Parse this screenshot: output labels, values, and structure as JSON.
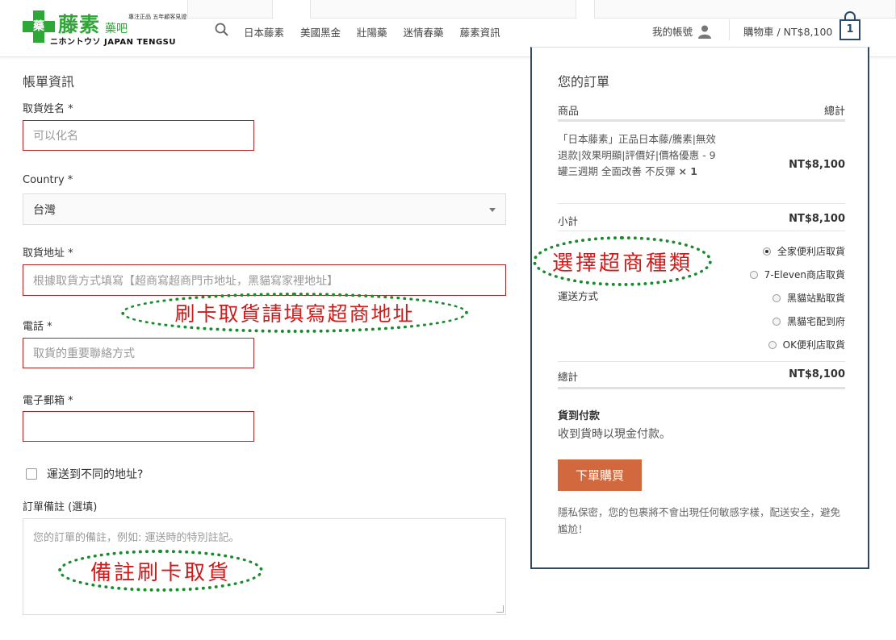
{
  "header": {
    "logo": {
      "mark_char": "藥",
      "main_text": "藤素",
      "small_text": "藥吧",
      "tagline": "專注正品 五年顧客見證",
      "subtitle": "ニホントウソ JAPAN TENGSU"
    },
    "nav": [
      "日本藤素",
      "美國黑金",
      "壯陽藥",
      "迷情春藥",
      "藤素資訊"
    ],
    "account_label": "我的帳號",
    "cart_label": "購物車 / NT$8,100",
    "cart_count": "1"
  },
  "billing": {
    "title": "帳單資訊",
    "name_label": "取貨姓名",
    "name_placeholder": "可以化名",
    "country_label": "Country",
    "country_value": "台灣",
    "address_label": "取貨地址",
    "address_placeholder": "根據取貨方式填寫【超商寫超商門市地址，黑貓寫家裡地址】",
    "phone_label": "電話",
    "phone_placeholder": "取貨的重要聯絡方式",
    "email_label": "電子郵箱",
    "email_placeholder": "",
    "required_mark": "*",
    "ship_different_label": "運送到不同的地址?",
    "notes_label": "訂單備註 (選填)",
    "notes_placeholder": "您的訂單的備註，例如: 運送時的特別註記。"
  },
  "annotations": {
    "address_note": "刷卡取貨請填寫超商地址",
    "shipping_note": "選擇超商種類",
    "notes_note": "備註刷卡取貨"
  },
  "order": {
    "title": "您的訂單",
    "col_product": "商品",
    "col_total": "總計",
    "item_name": "「日本藤素」正品日本藤/騰素|無效退款|效果明顯|評價好|價格優惠 - 9罐三週期 全面改善 不反彈",
    "item_qty": "× 1",
    "item_total": "NT$8,100",
    "subtotal_label": "小計",
    "subtotal_value": "NT$8,100",
    "shipping_label": "運送方式",
    "shipping_options": [
      {
        "label": "全家便利店取貨",
        "selected": true
      },
      {
        "label": "7-Eleven商店取貨",
        "selected": false
      },
      {
        "label": "黑貓站點取貨",
        "selected": false
      },
      {
        "label": "黑貓宅配到府",
        "selected": false
      },
      {
        "label": "OK便利店取貨",
        "selected": false
      }
    ],
    "total_label": "總計",
    "total_value": "NT$8,100",
    "payment_title": "貨到付款",
    "payment_desc": "收到貨時以現金付款。",
    "place_order_label": "下單購買",
    "privacy_note": "隱私保密，您的包裹將不會出現任何敏感字樣，配送安全，避免尷尬！"
  },
  "colors": {
    "brand_green": "#2da836",
    "error_border": "#b22222",
    "order_border": "#2f4a66",
    "button": "#d2693e",
    "annotation_text": "#d11a1a",
    "annotation_ring": "#1a8a2e"
  }
}
